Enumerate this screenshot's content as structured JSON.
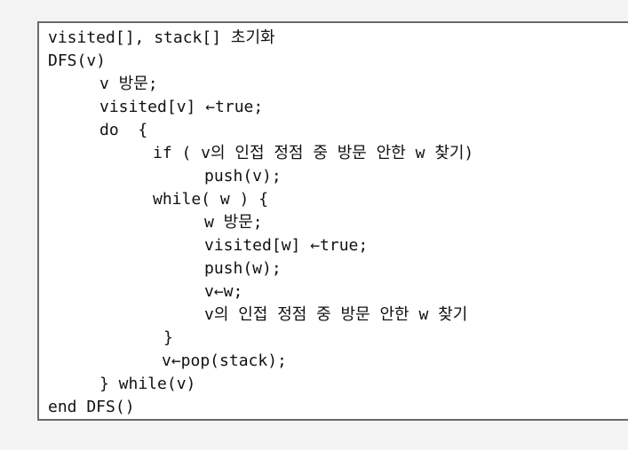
{
  "code": {
    "lines": [
      "visited[], stack[] 초기화",
      "DFS(v)",
      "v 방문;",
      "visited[v] ←true;",
      "do  {",
      "if ( v의 인접 정점 중 방문 안한 w 찾기)",
      "push(v);",
      "while( w ) {",
      "w 방문;",
      "visited[w] ←true;",
      "push(w);",
      "v←w;",
      "v의 인접 정점 중 방문 안한 w 찾기",
      "}",
      "v←pop(stack);",
      "} while(v)",
      "end DFS()"
    ]
  }
}
